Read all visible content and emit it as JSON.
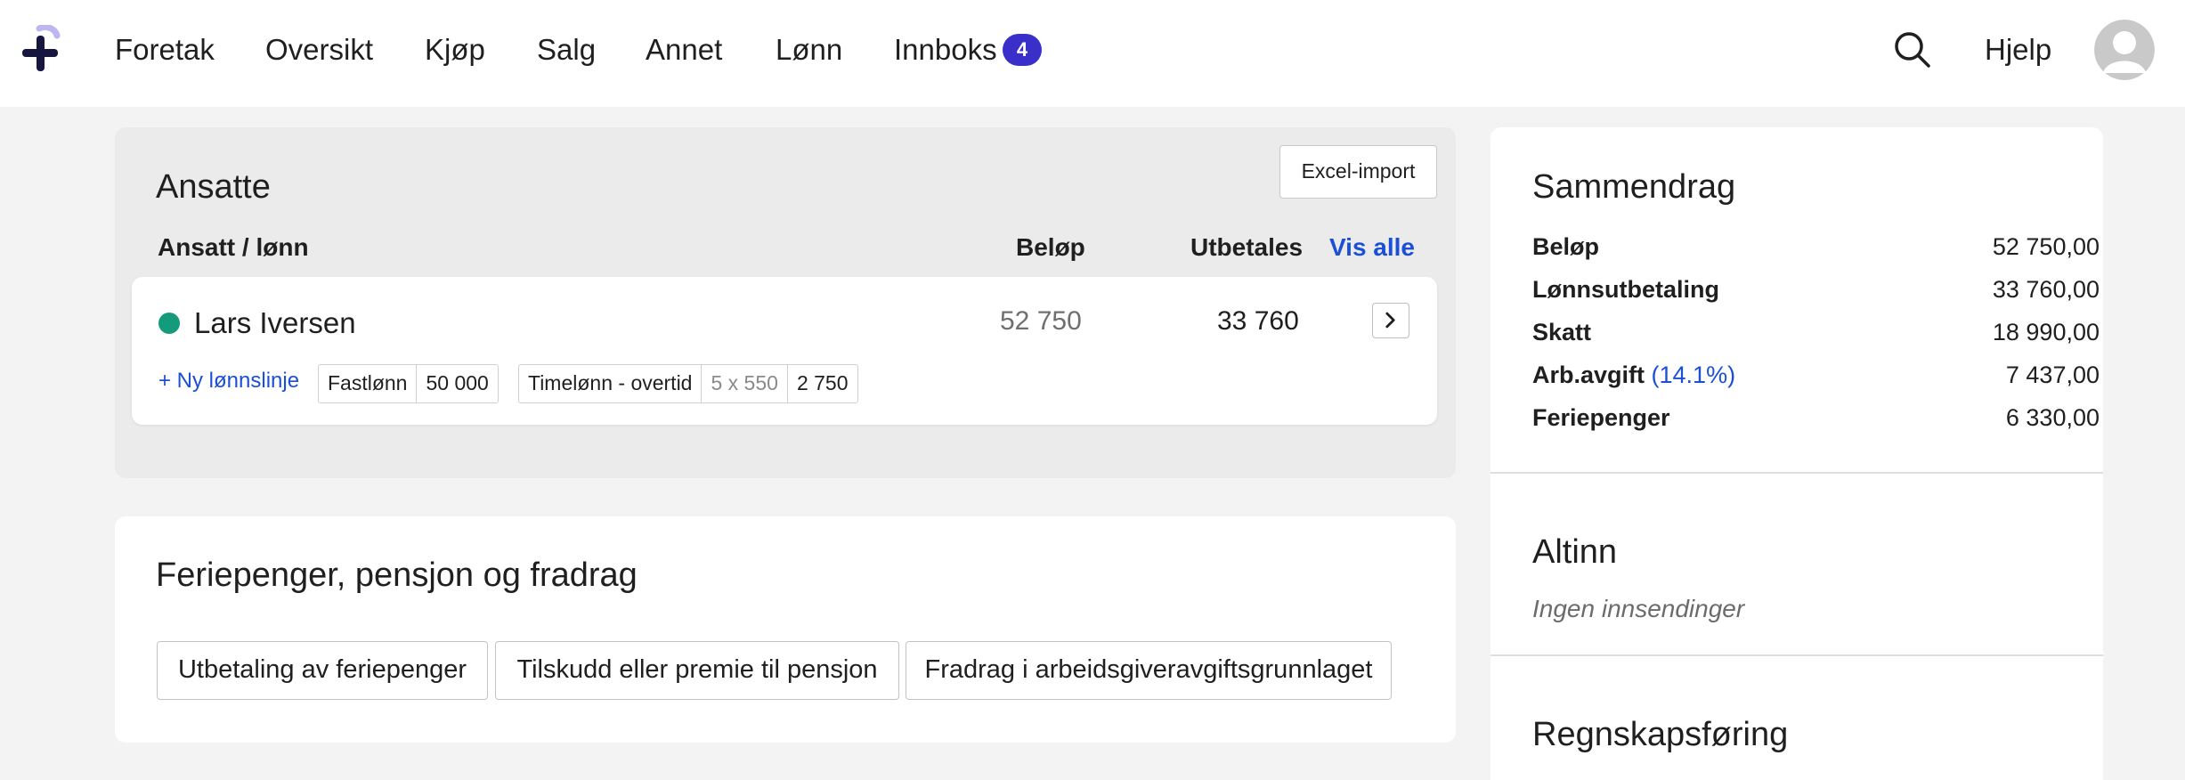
{
  "nav": {
    "items": [
      "Foretak",
      "Oversikt",
      "Kjøp",
      "Salg",
      "Annet",
      "Lønn",
      "Innboks"
    ],
    "inbox_count": "4",
    "help": "Hjelp"
  },
  "employees": {
    "title": "Ansatte",
    "excel_import": "Excel-import",
    "columns": {
      "employee": "Ansatt / lønn",
      "amount": "Beløp",
      "payout": "Utbetales",
      "show_all": "Vis alle"
    },
    "rows": [
      {
        "name": "Lars Iversen",
        "amount": "52 750",
        "payout": "33 760",
        "status_color": "#139b7c",
        "new_line": "+ Ny lønnslinje",
        "pay_lines": [
          {
            "label": "Fastlønn",
            "value": "50 000"
          },
          {
            "label": "Timelønn - overtid",
            "qty": "5 x 550",
            "value": "2 750"
          }
        ]
      }
    ]
  },
  "holiday": {
    "title": "Feriepenger, pensjon og fradrag",
    "buttons": [
      "Utbetaling av feriepenger",
      "Tilskudd eller premie til pensjon",
      "Fradrag i arbeidsgiveravgiftsgrunnlaget"
    ]
  },
  "summary": {
    "title": "Sammendrag",
    "rows": [
      {
        "label": "Beløp",
        "value": "52 750,00"
      },
      {
        "label": "Lønnsutbetaling",
        "value": "33 760,00"
      },
      {
        "label": "Skatt",
        "value": "18 990,00"
      },
      {
        "label": "Arb.avgift",
        "pct": "(14.1%)",
        "value": "7 437,00"
      },
      {
        "label": "Feriepenger",
        "value": "6 330,00"
      }
    ]
  },
  "altinn": {
    "title": "Altinn",
    "status": "Ingen innsendinger"
  },
  "accounting": {
    "title": "Regnskapsføring"
  },
  "colors": {
    "accent": "#3b2fc9",
    "link": "#1a4fd6",
    "status_active": "#139b7c"
  }
}
